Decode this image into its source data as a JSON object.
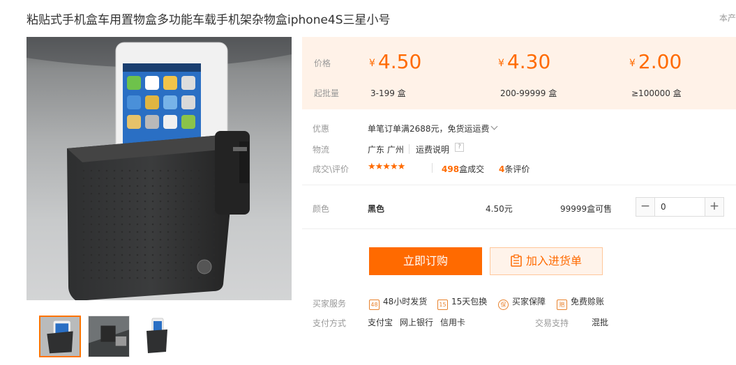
{
  "product": {
    "title": "粘贴式手机盒车用置物盒多功能车载手机架杂物盒iphone4S三星小号",
    "corner_text": "本产"
  },
  "pricing": {
    "price_label": "价格",
    "min_label": "起批量",
    "currency": "¥",
    "tiers": [
      {
        "price": "4.50",
        "range": "3-199 盒"
      },
      {
        "price": "4.30",
        "range": "200-99999 盒"
      },
      {
        "price": "2.00",
        "range": "≥100000 盒"
      }
    ]
  },
  "info": {
    "promo_label": "优惠",
    "promo_text": "单笔订单满2688元，免货运运费",
    "logistics_label": "物流",
    "origin": "广东 广州",
    "shipping_note": "运费说明",
    "shipping_help": "?",
    "deals_label": "成交\\评价",
    "stars": "★★★★★",
    "deals_count": "498",
    "deals_suffix": "盒成交",
    "review_count": "4",
    "review_suffix": "条评价"
  },
  "variant": {
    "color_label": "颜色",
    "color_value": "黑色",
    "unit_price": "4.50元",
    "stock": "99999盒可售",
    "qty_minus": "−",
    "qty_plus": "+",
    "qty_value": "0"
  },
  "actions": {
    "buy_now": "立即订购",
    "add_to_cart": "加入进货单"
  },
  "services": {
    "label": "买家服务",
    "items": [
      {
        "badge": "48",
        "text": "48小时发货"
      },
      {
        "badge": "15",
        "text": "15天包换"
      },
      {
        "badge": "保",
        "text": "买家保障"
      },
      {
        "badge": "赔",
        "text": "免费赊账"
      }
    ]
  },
  "payment": {
    "label": "支付方式",
    "methods": [
      "支付宝",
      "网上银行",
      "信用卡"
    ],
    "trade_label": "交易支持",
    "trade_value": "混批"
  },
  "colors": {
    "accent": "#ff6a00",
    "price_band": "#fff2e8"
  }
}
